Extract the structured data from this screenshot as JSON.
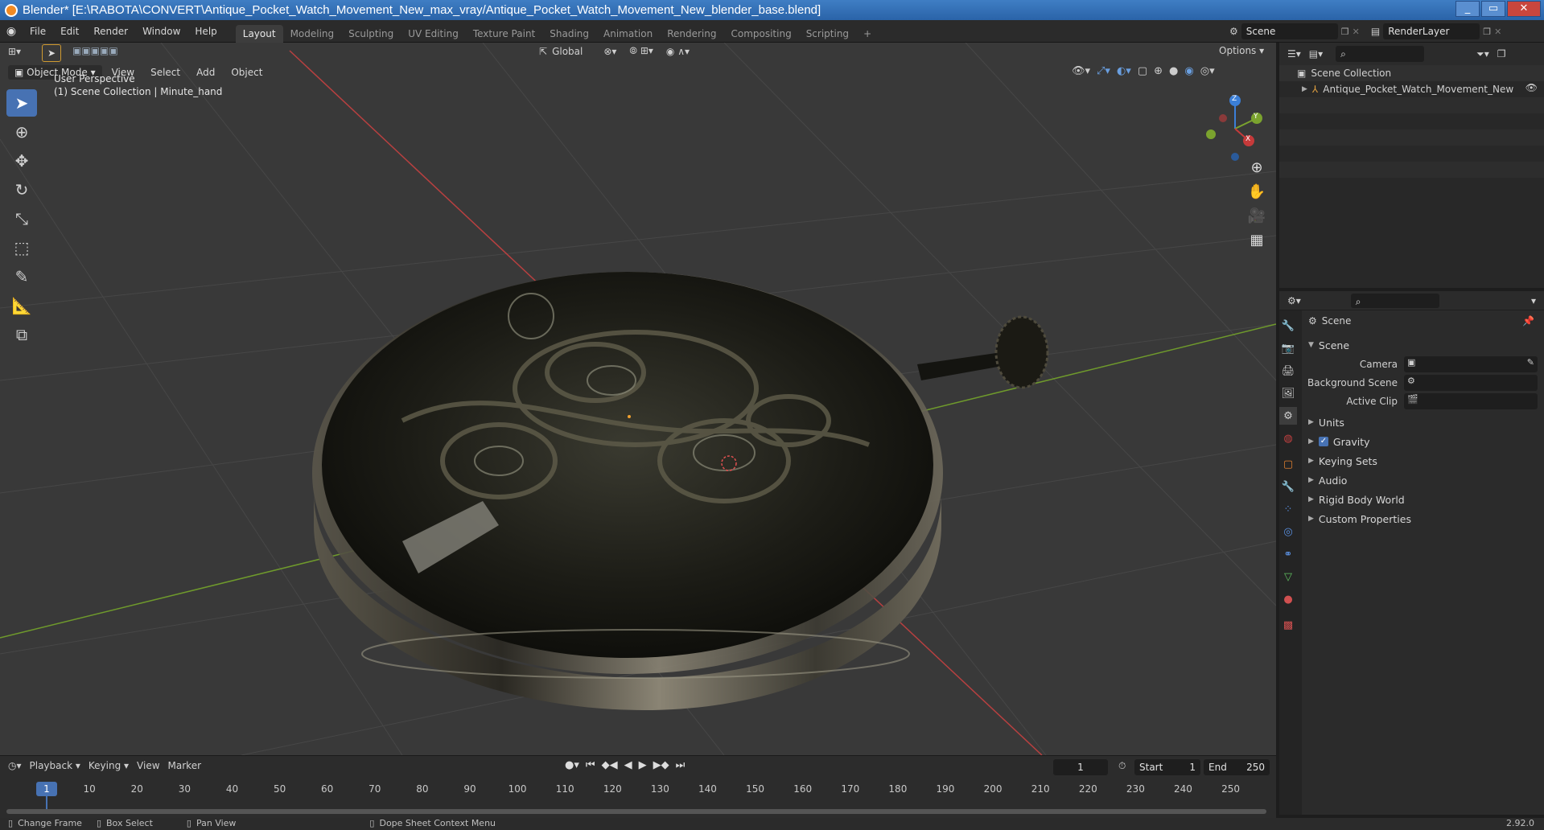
{
  "window": {
    "title": "Blender* [E:\\RABOTA\\CONVERT\\Antique_Pocket_Watch_Movement_New_max_vray/Antique_Pocket_Watch_Movement_New_blender_base.blend]",
    "minimize": "_",
    "maximize": "▭",
    "close": "✕"
  },
  "menu": {
    "items": [
      "File",
      "Edit",
      "Render",
      "Window",
      "Help"
    ]
  },
  "workspaces": [
    "Layout",
    "Modeling",
    "Sculpting",
    "UV Editing",
    "Texture Paint",
    "Shading",
    "Animation",
    "Rendering",
    "Compositing",
    "Scripting"
  ],
  "add_workspace": "+",
  "scene_selector": "Scene",
  "renderlayer_selector": "RenderLayer",
  "viewport": {
    "transform_orientation": "Global",
    "options_label": "Options",
    "mode": "Object Mode",
    "header_menus": [
      "View",
      "Select",
      "Add",
      "Object"
    ],
    "info_line1": "User Perspective",
    "info_line2": "(1) Scene Collection | Minute_hand",
    "gizmo": {
      "z": "Z",
      "y": "Y",
      "x": "X"
    }
  },
  "outliner": {
    "root": "Scene Collection",
    "items": [
      "Antique_Pocket_Watch_Movement_New"
    ]
  },
  "properties": {
    "header": "Scene",
    "panel": "Scene",
    "fields": [
      {
        "label": "Camera"
      },
      {
        "label": "Background Scene"
      },
      {
        "label": "Active Clip"
      }
    ],
    "subpanels": [
      "Units",
      "Gravity",
      "Keying Sets",
      "Audio",
      "Rigid Body World",
      "Custom Properties"
    ],
    "gravity_checked": true
  },
  "timeline": {
    "menus": [
      "Playback",
      "Keying",
      "View",
      "Marker"
    ],
    "current_frame": "1",
    "start_label": "Start",
    "start": "1",
    "end_label": "End",
    "end": "250",
    "ticks": [
      "1",
      "10",
      "20",
      "30",
      "40",
      "50",
      "60",
      "70",
      "80",
      "90",
      "100",
      "110",
      "120",
      "130",
      "140",
      "150",
      "160",
      "170",
      "180",
      "190",
      "200",
      "210",
      "220",
      "230",
      "240",
      "250"
    ]
  },
  "statusbar": {
    "items": [
      "Change Frame",
      "Box Select",
      "Pan View",
      "Dope Sheet Context Menu"
    ],
    "version": "2.92.0"
  },
  "colors": {
    "accent": "#4772b3",
    "viewport_bg": "#393939",
    "x_axis": "#c63a3a",
    "y_axis": "#7ba32e",
    "z_axis": "#3b7fd8"
  }
}
